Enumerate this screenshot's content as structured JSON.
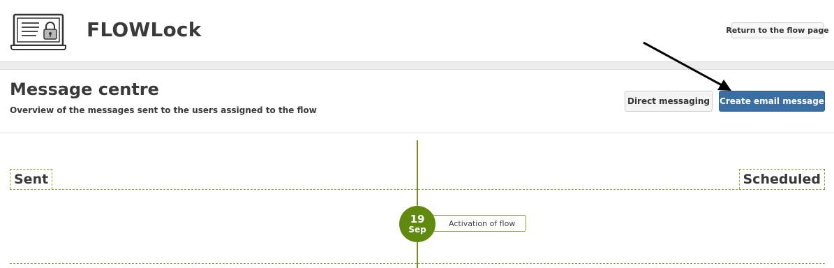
{
  "header": {
    "app_title": "FLOWLock",
    "logo_icon": "laptop-lock-icon",
    "return_button_label": "Return to the flow page"
  },
  "page": {
    "title": "Message centre",
    "subtitle": "Overview of the messages sent to the users assigned to the flow"
  },
  "actions": {
    "direct_messaging_label": "Direct messaging",
    "create_email_label": "Create email message",
    "primary_color": "#3b6fa3",
    "annotation_icon": "arrow-pointer-icon"
  },
  "timeline": {
    "sent_label": "Sent",
    "scheduled_label": "Scheduled",
    "accent_color": "#5f8a0e",
    "events": [
      {
        "day": "19",
        "month": "Sep",
        "label": "Activation of flow"
      }
    ]
  }
}
